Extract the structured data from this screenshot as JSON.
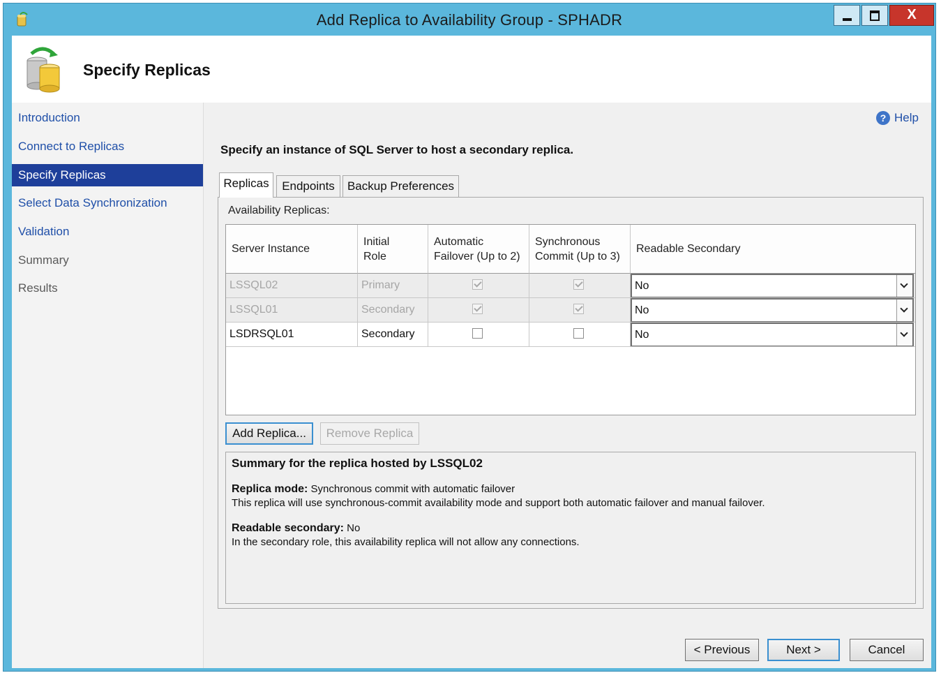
{
  "window": {
    "title": "Add Replica to Availability Group - SPHADR",
    "close_glyph": "X",
    "controls": [
      "minimize-icon",
      "maximize-icon",
      "close-icon"
    ]
  },
  "header": {
    "title": "Specify Replicas",
    "icon": "database-replica-icon"
  },
  "nav": {
    "items": [
      {
        "label": "Introduction",
        "state": "link"
      },
      {
        "label": "Connect to Replicas",
        "state": "link"
      },
      {
        "label": "Specify Replicas",
        "state": "active"
      },
      {
        "label": "Select Data Synchronization",
        "state": "link"
      },
      {
        "label": "Validation",
        "state": "link"
      },
      {
        "label": "Summary",
        "state": "disabled"
      },
      {
        "label": "Results",
        "state": "disabled"
      }
    ]
  },
  "help": {
    "label": "Help",
    "glyph": "?"
  },
  "instruction": "Specify an instance of SQL Server to host a secondary replica.",
  "tabs": [
    {
      "label": "Replicas",
      "active": true
    },
    {
      "label": "Endpoints",
      "active": false
    },
    {
      "label": "Backup Preferences",
      "active": false
    }
  ],
  "replicas_panel": {
    "label": "Availability Replicas:",
    "columns": [
      "Server Instance",
      "Initial Role",
      "Automatic Failover (Up to 2)",
      "Synchronous Commit (Up to 3)",
      "Readable Secondary"
    ],
    "rows": [
      {
        "server": "LSSQL02",
        "role": "Primary",
        "auto_failover": true,
        "sync_commit": true,
        "readable": "No",
        "enabled": false
      },
      {
        "server": "LSSQL01",
        "role": "Secondary",
        "auto_failover": true,
        "sync_commit": true,
        "readable": "No",
        "enabled": false
      },
      {
        "server": "LSDRSQL01",
        "role": "Secondary",
        "auto_failover": false,
        "sync_commit": false,
        "readable": "No",
        "enabled": true
      }
    ],
    "add_button": "Add Replica...",
    "remove_button": "Remove Replica"
  },
  "summary": {
    "title": "Summary for the replica hosted by LSSQL02",
    "replica_mode_label": "Replica mode:",
    "replica_mode_value": "Synchronous commit with automatic failover",
    "replica_mode_desc": "This replica will use synchronous-commit availability mode and support both automatic failover and manual failover.",
    "readable_label": "Readable secondary:",
    "readable_value": "No",
    "readable_desc": "In the secondary role, this availability replica will not allow any connections."
  },
  "footer": {
    "previous": "< Previous",
    "next": "Next >",
    "cancel": "Cancel"
  },
  "colors": {
    "title_bar": "#5bb7dc",
    "nav_active": "#1e3f9a",
    "link": "#1f4fa8",
    "close_button": "#c7352b"
  }
}
